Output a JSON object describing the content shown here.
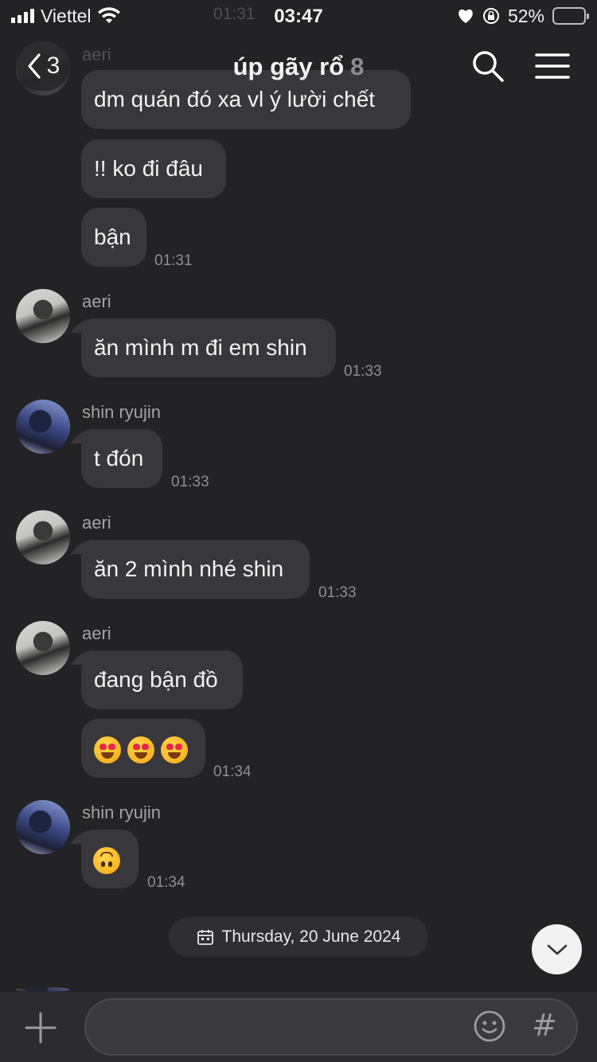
{
  "status_bar": {
    "carrier": "Viettel",
    "time": "03:47",
    "battery": "52%",
    "battery_level": 0.52,
    "ghost_time": "01:31"
  },
  "header": {
    "back_count": "3",
    "title": "úp gãy rổ",
    "member_count": "8"
  },
  "messages": {
    "top_name": "aeri",
    "m0_text": "dm quán đó xa vl ý lười chết",
    "m1_text": "!! ko đi đâu",
    "m2_text": "bận",
    "m2_time": "01:31",
    "m3_name": "aeri",
    "m3_text": "ăn mình m đi em shin",
    "m3_time": "01:33",
    "m4_name": "shin ryujin",
    "m4_text": "t đón",
    "m4_time": "01:33",
    "m5_name": "aeri",
    "m5_text": "ăn 2 mình nhé shin",
    "m5_time": "01:33",
    "m6_name": "aeri",
    "m6_text": "đang bận đồ",
    "m7_emoji": "heart-eyes x3",
    "m7_time": "01:34",
    "m8_name": "shin ryujin",
    "m8_emoji": "upside-down-face",
    "m8_time": "01:34"
  },
  "date_divider": "Thursday, 20 June 2024",
  "composer": {
    "placeholder": "",
    "hash_label": "#"
  },
  "colors": {
    "background": "#232325",
    "bubble": "#38383c",
    "battery_fill": "#f4cf3a"
  }
}
